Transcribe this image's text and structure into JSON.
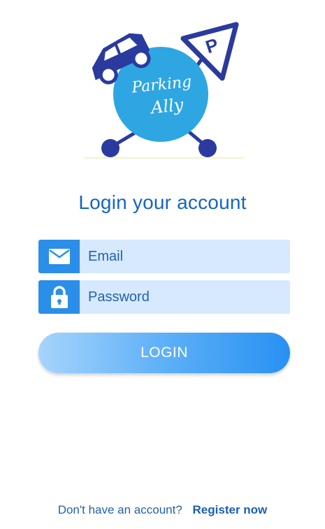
{
  "logo": {
    "text_line1": "Parking",
    "text_line2": "Ally",
    "sign_letter": "P"
  },
  "login": {
    "title": "Login your account",
    "email_placeholder": "Email",
    "password_placeholder": "Password",
    "button_label": "LOGIN"
  },
  "footer": {
    "question": "Don't have an account?",
    "register_label": "Register now"
  },
  "icons": {
    "email": "envelope-icon",
    "password": "lock-icon"
  },
  "colors": {
    "primary_text": "#1565c0",
    "icon_box": "#2b8ee8",
    "input_bg": "#d6e9ff",
    "logo_circle": "#2ea6e2",
    "logo_dark": "#2a3a9e"
  }
}
